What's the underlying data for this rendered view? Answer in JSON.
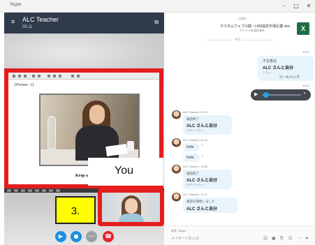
{
  "window": {
    "app_name": "Skype",
    "minimize_glyph": "–",
    "maximize_glyph": "□",
    "close_glyph": "✕"
  },
  "call": {
    "title": "ALC Teacher",
    "duration": "05:11",
    "menu_glyph": "≡",
    "expand_glyph": "⧉",
    "document": {
      "label": "[Picture -1]",
      "caption": "Keep a p"
    },
    "you_label": "You",
    "step_label": "3.",
    "controls": [
      {
        "name": "video-icon",
        "glyph": "▶",
        "color": "#1a8fe3"
      },
      {
        "name": "microphone-icon",
        "glyph": "●",
        "color": "#1a8fe3"
      },
      {
        "name": "more-icon",
        "glyph": "•••",
        "color": "#9aa0a6"
      },
      {
        "name": "hang-up-icon",
        "glyph": "☎",
        "color": "#e3242b"
      }
    ]
  },
  "chat": {
    "file_message": {
      "sender": "小田口",
      "file_name": "カスタムウェブ公開・LMS設定手順企業.xlsx",
      "file_size": "ファイルを送信済み",
      "icon": "excel-icon",
      "icon_letter": "X"
    },
    "date_separator": "今日",
    "call_card": {
      "time": "10:13",
      "title": "不在着信",
      "name": "ALC さんと自分",
      "sub": "したい",
      "button": "コールバック"
    },
    "audio": {
      "time": "10:13",
      "progress": 0.1
    },
    "messages": [
      {
        "meta": "ALC Teacher, 10:13",
        "title": "通話終了",
        "bold": "ALC さんと自分",
        "sub": "ログインチャ"
      },
      {
        "meta": "ALC Teacher, 10:14",
        "lines": [
          "hello",
          "hello"
        ]
      },
      {
        "meta": "ALC Teacher, 11:08",
        "title": "通話終了",
        "bold": "ALC さんと自分",
        "sub": "ログインチャ"
      },
      {
        "meta": "ALC Teacher, 11:12",
        "title": "通話を開始しました",
        "bold": "ALC さんと自分"
      }
    ],
    "compose": {
      "to_label": "宛先: Skype",
      "placeholder": "メッセージを入力"
    }
  }
}
